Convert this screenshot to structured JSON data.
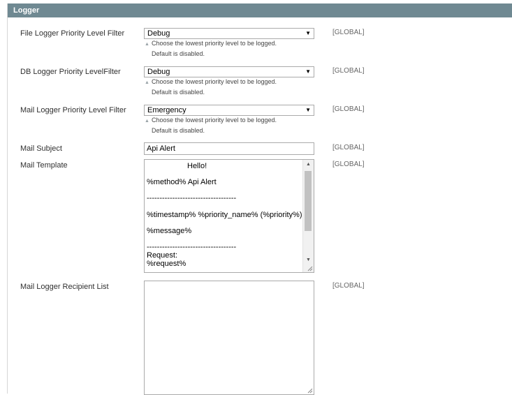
{
  "section": {
    "title": "Logger"
  },
  "fields": {
    "file_logger": {
      "label": "File Logger Priority Level Filter",
      "value": "Debug",
      "note_line1": "Choose the lowest priority level to be logged.",
      "note_line2": "Default is disabled.",
      "scope": "[GLOBAL]"
    },
    "db_logger": {
      "label": "DB Logger Priority LevelFilter",
      "value": "Debug",
      "note_line1": "Choose the lowest priority level to be logged.",
      "note_line2": "Default is disabled.",
      "scope": "[GLOBAL]"
    },
    "mail_logger": {
      "label": "Mail Logger Priority Level Filter",
      "value": "Emergency",
      "note_line1": "Choose the lowest priority level to be logged.",
      "note_line2": "Default is disabled.",
      "scope": "[GLOBAL]"
    },
    "mail_subject": {
      "label": "Mail Subject",
      "value": "Api Alert",
      "scope": "[GLOBAL]"
    },
    "mail_template": {
      "label": "Mail Template",
      "lines": {
        "l1": "Hello!",
        "l2": "%method% Api Alert",
        "l3": "-----------------------------------",
        "l4": "%timestamp% %priority_name% (%priority%):",
        "l5": "%message%",
        "l6": "-----------------------------------",
        "l7": "Request:",
        "l8": "%request%"
      },
      "scope": "[GLOBAL]"
    },
    "recipient_list": {
      "label": "Mail Logger Recipient List",
      "value": "",
      "scope": "[GLOBAL]"
    }
  },
  "icons": {
    "dropdown": "chevron-down-icon",
    "note": "triangle-up-icon",
    "scroll_up": "scroll-up-arrow-icon",
    "scroll_down": "scroll-down-arrow-icon",
    "resize": "resize-grip-icon"
  }
}
